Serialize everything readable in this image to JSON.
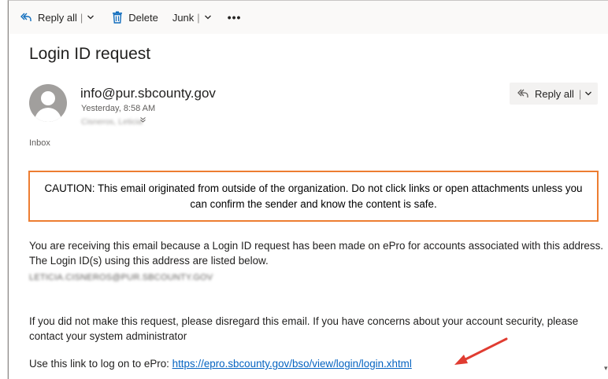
{
  "toolbar": {
    "reply_all": "Reply all",
    "delete": "Delete",
    "junk": "Junk",
    "more": "•••"
  },
  "message": {
    "subject": "Login ID request",
    "sender": "info@pur.sbcounty.gov",
    "time": "Yesterday, 8:58 AM",
    "to": "Cisneros, Leticia",
    "folder": "Inbox",
    "reply_all_button": "Reply all",
    "caution": "CAUTION: This email originated from outside of the organization. Do not click links or open attachments unless you can confirm the sender and know the content is safe.",
    "paragraph1": "You are receiving this email because a Login ID request has been made on ePro for accounts associated with this address. The Login ID(s) using this address are listed below.",
    "login_id": "LETICIA.CISNEROS@PUR.SBCOUNTY.GOV",
    "paragraph2": "If you did not make this request, please disregard this email. If you have concerns about your account security, please contact your system administrator",
    "link_prefix": "Use this link to log on to ePro: ",
    "link_url": "https://epro.sbcounty.gov/bso/view/login/login.xhtml"
  },
  "colors": {
    "accent": "#0f6cbd",
    "caution_border": "#ed7d31",
    "link": "#0563c1",
    "annotation_arrow": "#e03c31"
  }
}
